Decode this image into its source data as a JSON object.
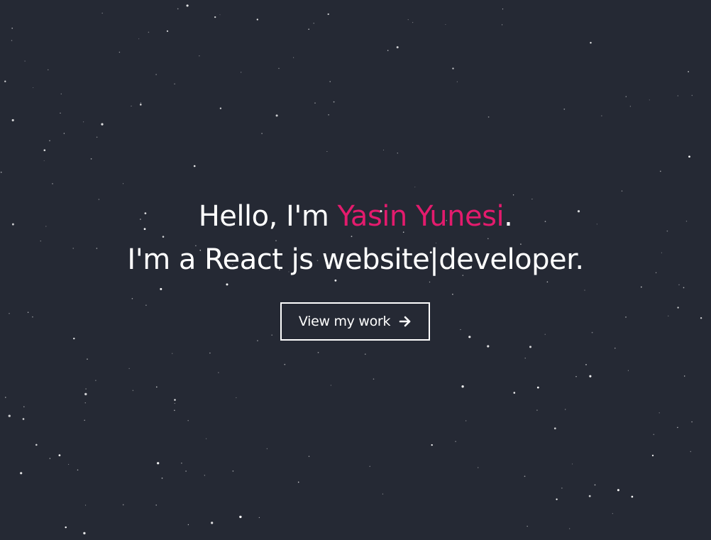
{
  "hero": {
    "greeting": "Hello, I'm ",
    "name": "Yasin Yunesi",
    "period": ".",
    "role_prefix": "I'm a React js website",
    "cursor": "|",
    "role_suffix": "developer.",
    "cta_label": "View my work",
    "cta_icon": "arrow-right-icon"
  },
  "colors": {
    "background": "#252934",
    "accent": "#e31b6d",
    "text": "#ffffff"
  }
}
